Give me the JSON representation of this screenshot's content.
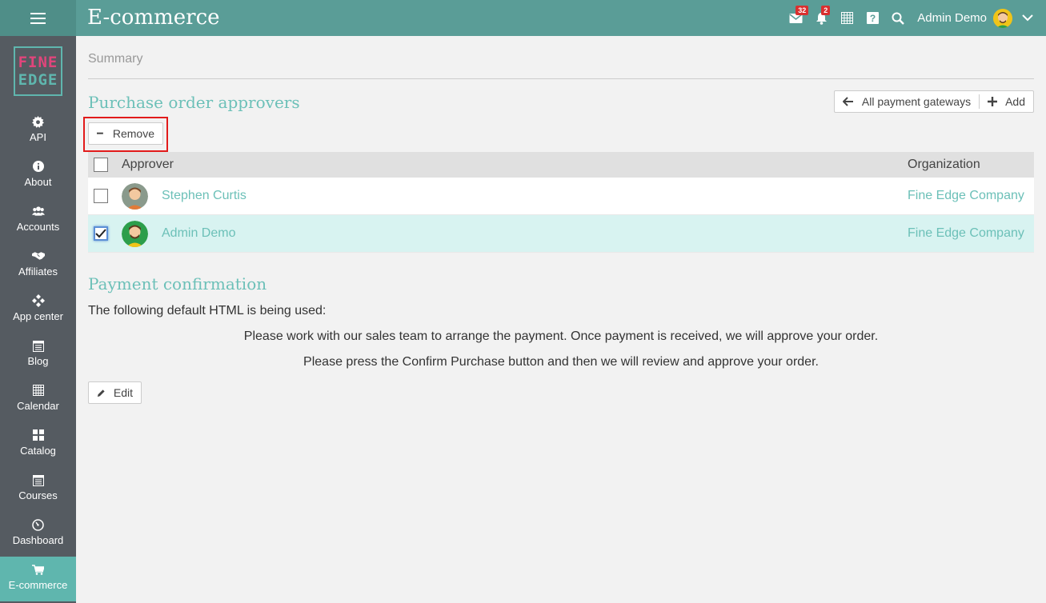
{
  "app": {
    "title": "E-commerce"
  },
  "topbar": {
    "mail_badge": "32",
    "bell_badge": "2",
    "user_name": "Admin Demo"
  },
  "sidebar": {
    "logo_line1": "FINE",
    "logo_line2": "EDGE",
    "items": [
      {
        "label": "API",
        "icon": "gear-icon"
      },
      {
        "label": "About",
        "icon": "info-icon"
      },
      {
        "label": "Accounts",
        "icon": "users-icon"
      },
      {
        "label": "Affiliates",
        "icon": "handshake-icon"
      },
      {
        "label": "App center",
        "icon": "apps-icon"
      },
      {
        "label": "Blog",
        "icon": "blog-icon"
      },
      {
        "label": "Calendar",
        "icon": "calendar-icon"
      },
      {
        "label": "Catalog",
        "icon": "grid-icon"
      },
      {
        "label": "Courses",
        "icon": "courses-icon"
      },
      {
        "label": "Dashboard",
        "icon": "dashboard-icon"
      },
      {
        "label": "E-commerce",
        "icon": "cart-icon",
        "active": true
      }
    ]
  },
  "main": {
    "breadcrumb": "Summary",
    "approvers_title": "Purchase order approvers",
    "all_gateways_label": "All payment gateways",
    "add_label": "Add",
    "remove_label": "Remove",
    "table": {
      "headers": {
        "approver": "Approver",
        "organization": "Organization"
      },
      "rows": [
        {
          "name": "Stephen Curtis",
          "organization": "Fine Edge Company",
          "checked": false
        },
        {
          "name": "Admin Demo",
          "organization": "Fine Edge Company",
          "checked": true
        }
      ]
    },
    "payment_title": "Payment confirmation",
    "payment_desc": "The following default HTML is being used:",
    "message_1": "Please work with our sales team to arrange the payment. Once payment is received, we will approve your order.",
    "message_2": "Please press the Confirm Purchase button and then we will review and approve your order.",
    "edit_label": "Edit"
  },
  "colors": {
    "topbar": "#5a9d97",
    "sidebar": "#555b61",
    "accent": "#6cc0b8",
    "highlight": "#e21b1b"
  }
}
